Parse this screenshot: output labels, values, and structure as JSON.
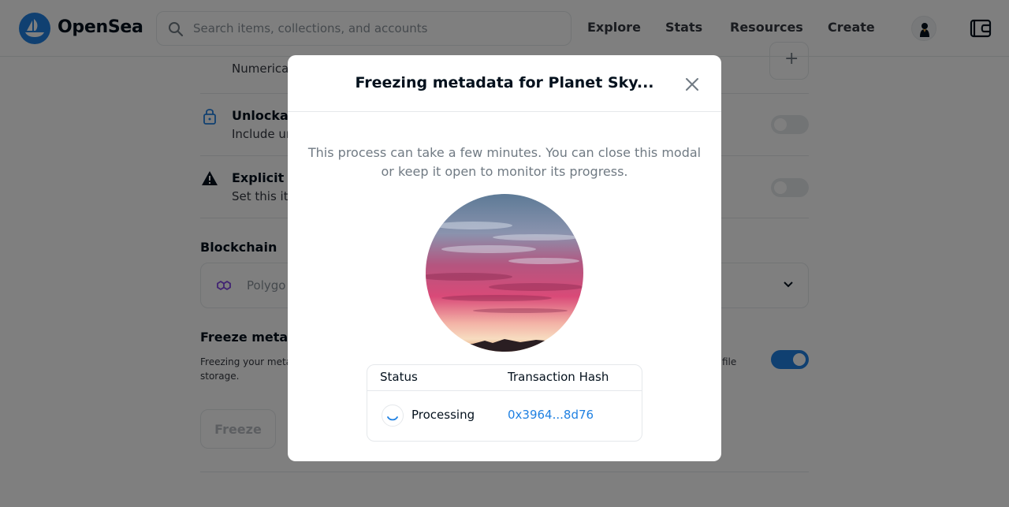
{
  "header": {
    "brand": "OpenSea",
    "search_placeholder": "Search items, collections, and accounts",
    "nav": [
      "Explore",
      "Stats",
      "Resources",
      "Create"
    ]
  },
  "page": {
    "properties_desc": "Numerica",
    "unlockable_title": "Unlockab",
    "unlockable_desc": "Include ur",
    "explicit_title": "Explicit &",
    "explicit_desc": "Set this ite",
    "blockchain_label": "Blockchain",
    "blockchain_value": "Polygo",
    "freeze_title": "Freeze metad",
    "freeze_desc_line1": "Freezing your meta",
    "freeze_desc_line1_end": "file",
    "freeze_desc_line2": "storage.",
    "freeze_button": "Freeze",
    "freeze_toggle_on": true
  },
  "modal": {
    "title": "Freezing metadata for Planet Sky...",
    "description": "This process can take a few minutes. You can close this modal or keep it open to monitor its progress.",
    "table": {
      "headers": [
        "Status",
        "Transaction Hash"
      ],
      "status": "Processing",
      "hash": "0x3964...8d76"
    }
  },
  "colors": {
    "accent": "#2081e2",
    "text": "#04111d",
    "muted": "#707a83",
    "border": "#e5e8eb"
  },
  "icons": [
    "opensea-logo-icon",
    "search-icon",
    "avatar-icon",
    "wallet-icon",
    "lock-icon",
    "warning-icon",
    "polygon-icon",
    "chevron-down-icon",
    "plus-icon",
    "close-icon",
    "spinner-icon"
  ]
}
